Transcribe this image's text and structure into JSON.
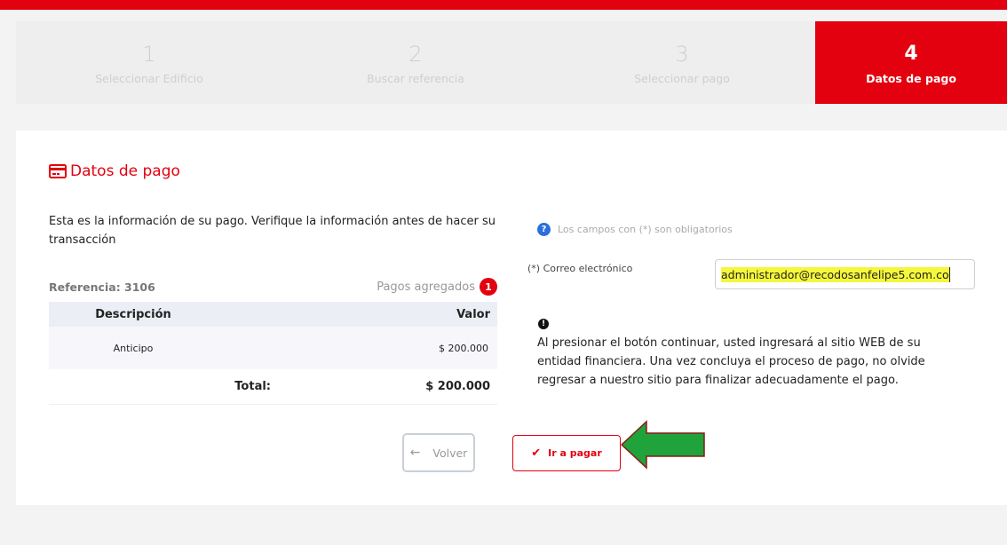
{
  "steps": [
    {
      "num": "1",
      "label": "Seleccionar Edificio"
    },
    {
      "num": "2",
      "label": "Buscar referencia"
    },
    {
      "num": "3",
      "label": "Seleccionar pago"
    },
    {
      "num": "4",
      "label": "Datos de pago"
    }
  ],
  "section_title": "Datos de pago",
  "intro": "Esta es la información de su pago. Verifique la información antes de hacer su transacción",
  "reference": "Referencia: 3106",
  "pagos_label": "Pagos agregados",
  "pagos_count": "1",
  "table": {
    "headers": [
      "Descripción",
      "Valor"
    ],
    "rows": [
      {
        "descripcion": "Anticipo",
        "valor": "$ 200.000"
      }
    ],
    "total_label": "Total:",
    "total_value": "$ 200.000"
  },
  "required_note": "Los campos con (*) son obligatorios",
  "email": {
    "label": "(*) Correo electrónico",
    "value": "administrador@recodosanfelipe5.com.co"
  },
  "info_text": "Al presionar el botón continuar, usted ingresará al sitio WEB de su entidad financiera. Una vez concluya el proceso de pago, no olvide regresar a nuestro sitio para finalizar adecuadamente el pago.",
  "buttons": {
    "back": "Volver",
    "pay": "Ir a pagar"
  },
  "icons": {
    "title": "credit-card-icon",
    "question": "question-circle-icon",
    "info": "info-circle-icon",
    "back": "arrow-left-icon",
    "pay": "check-icon",
    "pointer": "green-arrow-icon"
  },
  "colors": {
    "accent": "#e3000f",
    "highlight": "#f5f73a",
    "pointer": "#1fa33a"
  }
}
